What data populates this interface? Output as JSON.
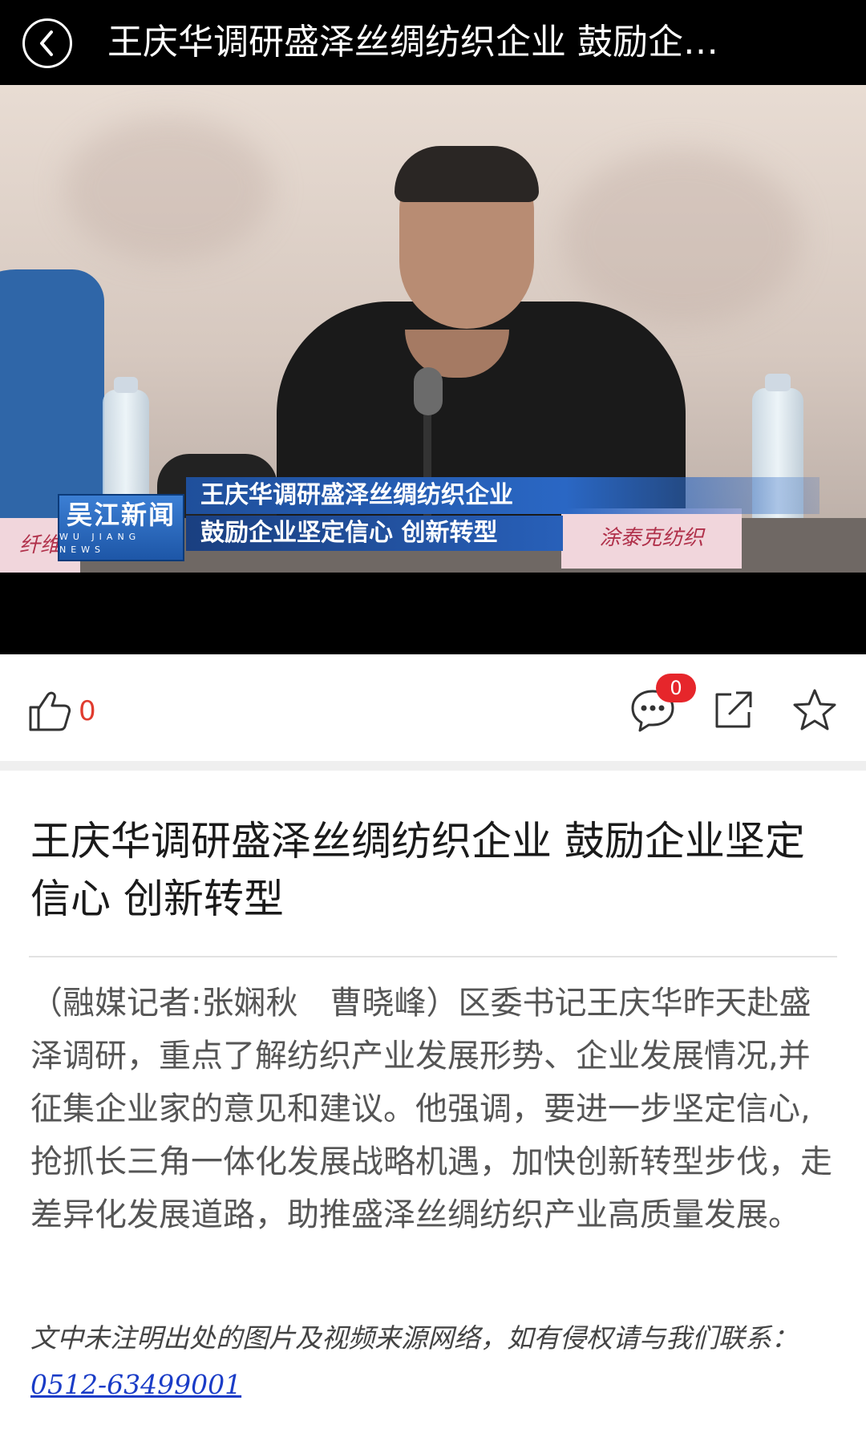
{
  "header": {
    "title": "王庆华调研盛泽丝绸纺织企业 鼓励企…",
    "back_icon": "chevron-left-icon"
  },
  "video": {
    "channel_logo": "吴江新闻",
    "channel_logo_sub": "WU JIANG NEWS",
    "caption_line1": "王庆华调研盛泽丝绸纺织企业",
    "caption_line2": "鼓励企业坚定信心 创新转型",
    "nameplate_right": "涂泰克纺织",
    "nameplate_left": "纤维"
  },
  "actions": {
    "like_icon": "thumbs-up-icon",
    "like_count": "0",
    "comment_icon": "comment-bubble-icon",
    "comment_count": "0",
    "share_icon": "share-external-icon",
    "favorite_icon": "star-icon",
    "accent_color": "#e03b2e"
  },
  "article": {
    "title": "王庆华调研盛泽丝绸纺织企业 鼓励企业坚定信心 创新转型",
    "body": "（融媒记者:张娴秋　曹晓峰）区委书记王庆华昨天赴盛泽调研，重点了解纺织产业发展形势、企业发展情况,并征集企业家的意见和建议。他强调，要进一步坚定信心,抢抓长三角一体化发展战略机遇，加快创新转型步伐，走差异化发展道路，助推盛泽丝绸纺织产业高质量发展。",
    "disclaimer_prefix": "文中未注明出处的图片及视频来源网络，如有侵权请与我们联系：",
    "phone": "0512-63499001"
  }
}
